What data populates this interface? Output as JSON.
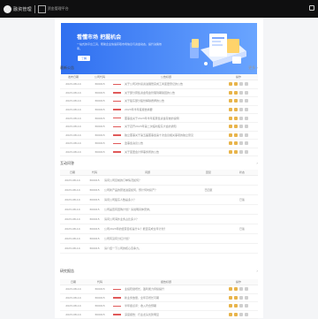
{
  "topbar": {
    "brand": "融资管理",
    "sub": "资金管理平台"
  },
  "banner": {
    "title": "看懂市场 把握机会",
    "desc": "一站式的平台工具，帮助企业快速获取市场信息与资金动态，提升决策效率。",
    "button": "了解"
  },
  "section1": {
    "title": "最新公告",
    "more": "更多 ›",
    "headers": [
      "发布日期",
      "公司代码",
      "公告标题",
      "操作"
    ],
    "rows": [
      {
        "date": "2023-08-14",
        "code": "300015",
        "title": "关于公司对外投资进展暨完成工商变更登记的公告"
      },
      {
        "date": "2023-08-14",
        "code": "300015",
        "title": "关于部分募集资金现金管理到期赎回的公告"
      },
      {
        "date": "2023-08-14",
        "code": "300015",
        "title": "关于股东部分股份解除质押的公告"
      },
      {
        "date": "2023-08-14",
        "code": "300015",
        "title": "2023年半年度报告摘要"
      },
      {
        "date": "2023-08-14",
        "code": "300015",
        "title": "董事会关于2023年半年度募集资金存放的说明"
      },
      {
        "date": "2023-08-14",
        "code": "300015",
        "title": "关于召开2023年第二次临时股东大会的通知"
      },
      {
        "date": "2023-08-14",
        "code": "300015",
        "title": "独立董事关于第五届董事会第十次会议相关事项的独立意见"
      },
      {
        "date": "2023-08-14",
        "code": "300015",
        "title": "监事会决议公告"
      },
      {
        "date": "2023-08-14",
        "code": "300015",
        "title": "关于变更会计师事务所的公告"
      }
    ]
  },
  "section2": {
    "title": "互动问答",
    "more": "›",
    "headers": [
      "日期",
      "代码",
      "问题",
      "回复",
      "状态"
    ],
    "rows": [
      {
        "date": "2023-08-14",
        "code": "300015",
        "q": "请问公司目前的订单情况如何？",
        "reply": "",
        "status": ""
      },
      {
        "date": "2023-08-14",
        "code": "300015",
        "q": "公司新产品的研发进度如何，预计何时投产？",
        "reply": "已回复",
        "status": ""
      },
      {
        "date": "2023-08-14",
        "code": "300015",
        "q": "请问公司股东人数是多少？",
        "reply": "",
        "status": "已答"
      },
      {
        "date": "2023-08-14",
        "code": "300015",
        "q": "公司是否有回购计划？请说明具体安排。",
        "reply": "",
        "status": ""
      },
      {
        "date": "2023-08-14",
        "code": "300015",
        "q": "请问公司海外业务占比多少？",
        "reply": "",
        "status": ""
      },
      {
        "date": "2023-08-14",
        "code": "300015",
        "q": "公司2023年的经营目标是什么？能否完成全年计划？",
        "reply": "",
        "status": "已答"
      },
      {
        "date": "2023-08-14",
        "code": "300015",
        "q": "公司有没有分红计划？",
        "reply": "",
        "status": ""
      },
      {
        "date": "2023-08-14",
        "code": "300015",
        "q": "请介绍一下公司的核心竞争力。",
        "reply": "",
        "status": ""
      }
    ]
  },
  "section3": {
    "title": "研究报告",
    "more": "›",
    "headers": [
      "日期",
      "代码",
      "报告标题",
      "操作"
    ],
    "rows": [
      {
        "date": "2023-08-14",
        "code": "300015",
        "title": "业绩稳健增长，盈利能力持续提升"
      },
      {
        "date": "2023-08-14",
        "code": "300015",
        "title": "新业务放量，全年高增长可期"
      },
      {
        "date": "2023-08-14",
        "code": "300015",
        "title": "半年报点评：收入符合预期"
      },
      {
        "date": "2023-08-14",
        "code": "300015",
        "title": "深度报告：行业龙头优势明显"
      }
    ]
  }
}
